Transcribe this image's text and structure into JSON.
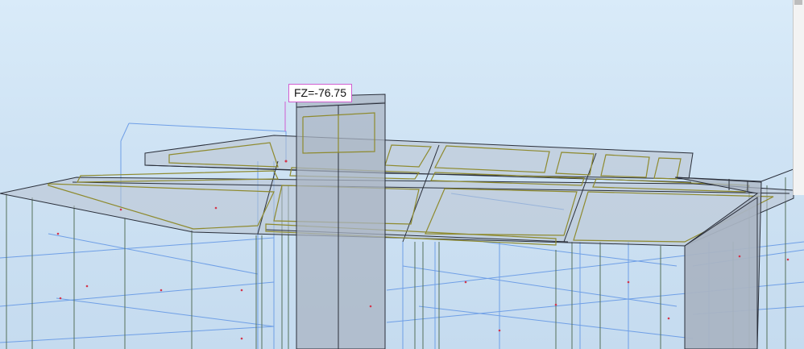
{
  "viewport": {
    "background_top": "#d9ebf9",
    "background_bottom": "#c5dbef"
  },
  "annotation": {
    "force_label": "FZ=-76.75",
    "border_color": "#d05ed0"
  },
  "colors": {
    "grid_lines": "#6f9fe6",
    "columns": "#55705a",
    "slab_outline": "#8e8a2e",
    "edges": "#2a2f3a",
    "nodes": "#d4364c"
  }
}
